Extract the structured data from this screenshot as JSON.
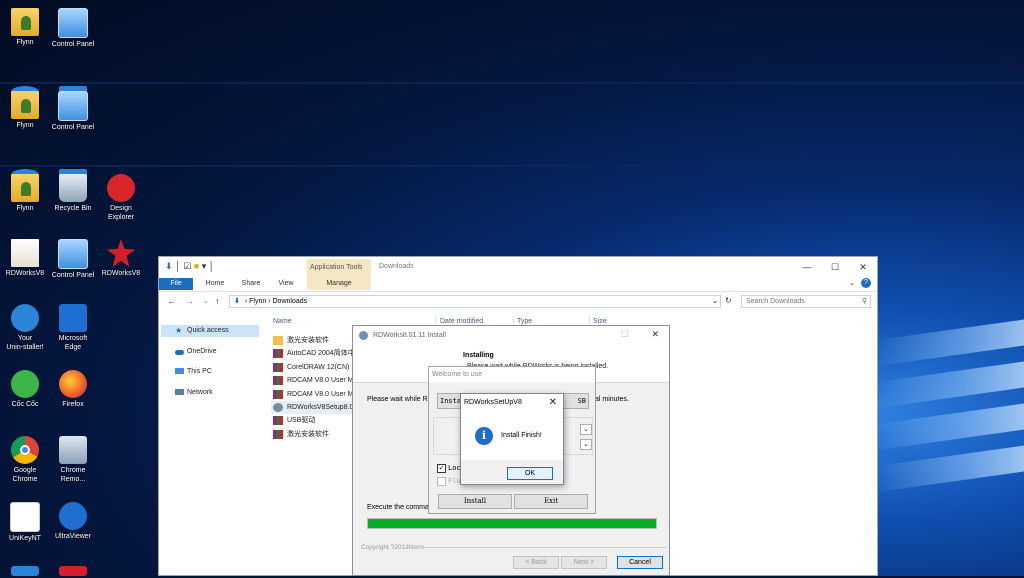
{
  "desktop": {
    "icons": [
      {
        "label": "Flynn"
      },
      {
        "label": "Control Panel"
      },
      {
        "label": "Flynn"
      },
      {
        "label": "Control Panel"
      },
      {
        "label": "Flynn"
      },
      {
        "label": "Recycle Bin"
      },
      {
        "label": "Design\nExplorer"
      },
      {
        "label": "RDWorksV8"
      },
      {
        "label": "Control Panel"
      },
      {
        "label": "RDWorksV8"
      },
      {
        "label": "Your\nUnin-staller!"
      },
      {
        "label": "Microsoft\nEdge"
      },
      {
        "label": "Cốc Cốc"
      },
      {
        "label": "Firefox"
      },
      {
        "label": "Google\nChrome"
      },
      {
        "label": "Chrome\nRemo..."
      },
      {
        "label": "UniKeyNT"
      },
      {
        "label": "UltraViewer"
      }
    ]
  },
  "explorer": {
    "title": "Downloads",
    "app_tools": "Application Tools",
    "ribbon_tabs": [
      "File",
      "Home",
      "Share",
      "View",
      "Manage"
    ],
    "breadcrumb": [
      "Flynn",
      "Downloads"
    ],
    "search_placeholder": "Search Downloads",
    "nav": [
      "Quick access",
      "OneDrive",
      "This PC",
      "Network"
    ],
    "columns": [
      "Name",
      "Date modified",
      "Type",
      "Size"
    ],
    "files": [
      "激光安装软件",
      "AutoCAD 2004简体中",
      "CorelDRAW 12(CN)",
      "RDCAM V8.0 User M",
      "RDCAM V8.0 User M",
      "RDWorksV8Setup8.0",
      "USB驱动",
      "激光安装软件"
    ]
  },
  "installer": {
    "title": "RDWorks8.01.11 Install",
    "header_title": "Installing",
    "header_sub": "Please wait while RDWorks is being installed.",
    "body_left": "Please wait while RD",
    "body_right": "al minutes.",
    "exec_text": "Execute the comma",
    "progress_percent": 100,
    "copyright": "Copyright ?2013None",
    "back": "< Back",
    "next": "Next >",
    "cancel": "Cancel"
  },
  "welcome": {
    "title": "Welcome to use",
    "install_top": "Insta",
    "usb_top": "SB",
    "check1": "Loc",
    "check2": "Flu",
    "install_btn": "Install",
    "exit_btn": "Exit"
  },
  "msgbox": {
    "title": "RDWorksSetUpV8",
    "message": "Install Finish!",
    "ok": "OK"
  }
}
